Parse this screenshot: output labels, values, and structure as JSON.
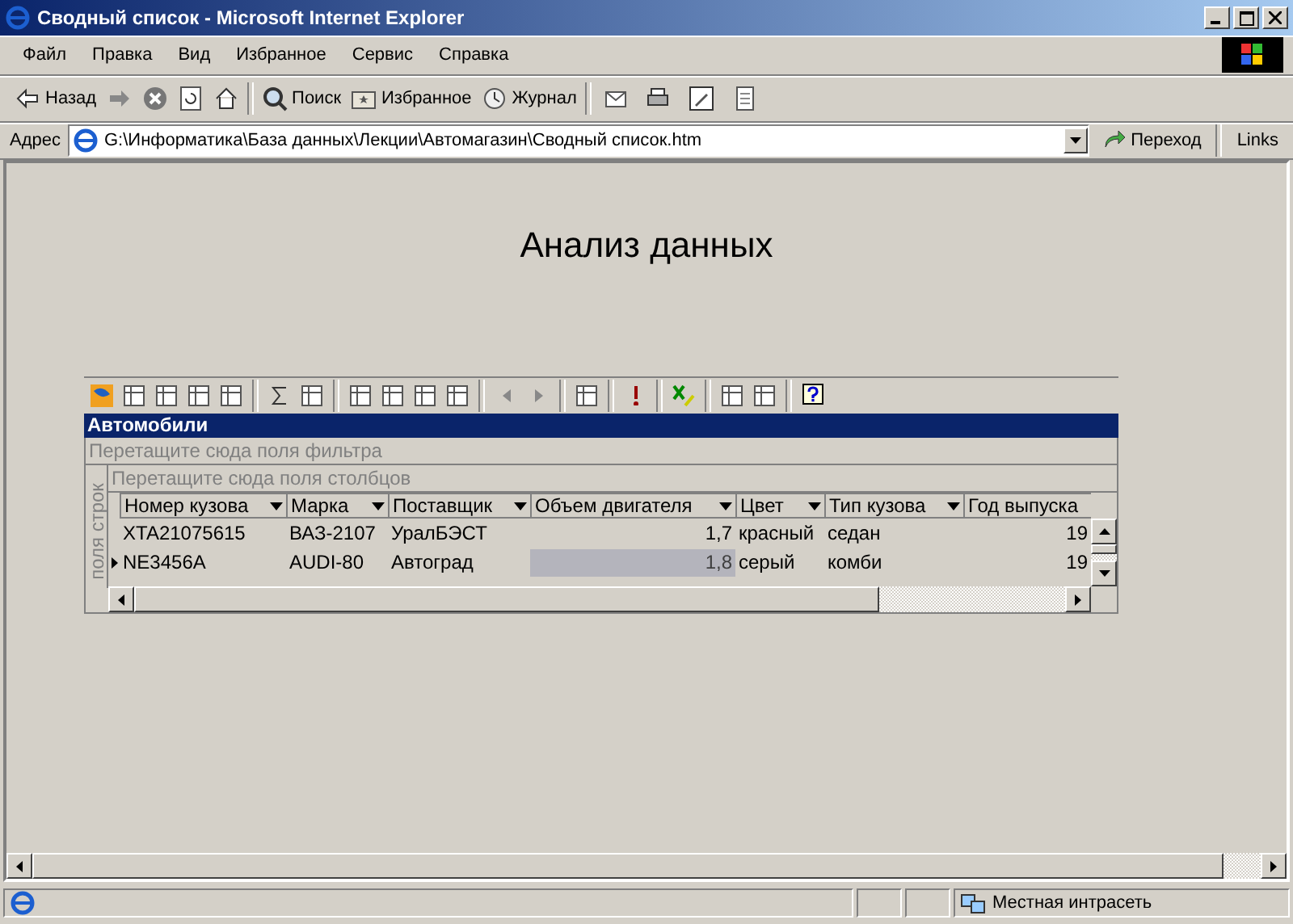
{
  "window": {
    "title": "Сводный список - Microsoft Internet Explorer"
  },
  "menu": [
    "Файл",
    "Правка",
    "Вид",
    "Избранное",
    "Сервис",
    "Справка"
  ],
  "toolbar": [
    {
      "kind": "back",
      "label": "Назад"
    },
    {
      "kind": "forward"
    },
    {
      "kind": "stop"
    },
    {
      "kind": "refresh"
    },
    {
      "kind": "home"
    },
    {
      "kind": "search",
      "label": "Поиск"
    },
    {
      "kind": "favorites",
      "label": "Избранное"
    },
    {
      "kind": "history",
      "label": "Журнал"
    },
    {
      "kind": "mail"
    },
    {
      "kind": "print"
    },
    {
      "kind": "edit"
    },
    {
      "kind": "discuss"
    }
  ],
  "address": {
    "label": "Адрес",
    "value": "G:\\Информатика\\База данных\\Лекции\\Автомагазин\\Сводный список.htm",
    "go": "Переход",
    "links": "Links"
  },
  "heading": "Анализ данных",
  "pivot": {
    "title": "Автомобили",
    "filter_placeholder": "Перетащите сюда поля фильтра",
    "column_placeholder": "Перетащите сюда поля столбцов",
    "row_placeholder": "поля строк",
    "columns": [
      {
        "label": "Номер кузова",
        "dropdown": true
      },
      {
        "label": "Марка",
        "dropdown": true
      },
      {
        "label": "Поставщик",
        "dropdown": true
      },
      {
        "label": "Объем двигателя",
        "dropdown": true
      },
      {
        "label": "Цвет",
        "dropdown": true
      },
      {
        "label": "Тип кузова",
        "dropdown": true
      },
      {
        "label": "Год выпуска",
        "dropdown": false
      }
    ],
    "rows": [
      {
        "selected": false,
        "cells": [
          {
            "text": "XTA21075615",
            "selected": false
          },
          {
            "text": "ВАЗ-2107",
            "selected": false
          },
          {
            "text": "УралБЭСТ",
            "selected": false
          },
          {
            "text": "1,7",
            "selected": false
          },
          {
            "text": "красный",
            "selected": false
          },
          {
            "text": "седан",
            "selected": false
          },
          {
            "text": "19",
            "selected": false
          }
        ]
      },
      {
        "selected": true,
        "cells": [
          {
            "text": "NE3456A",
            "selected": false
          },
          {
            "text": "AUDI-80",
            "selected": false
          },
          {
            "text": "Автоград",
            "selected": false
          },
          {
            "text": "1,8",
            "selected": true
          },
          {
            "text": "серый",
            "selected": false
          },
          {
            "text": "комби",
            "selected": false
          },
          {
            "text": "19",
            "selected": false
          }
        ]
      }
    ]
  },
  "status_bar": {
    "zone": "Местная интрасеть"
  }
}
